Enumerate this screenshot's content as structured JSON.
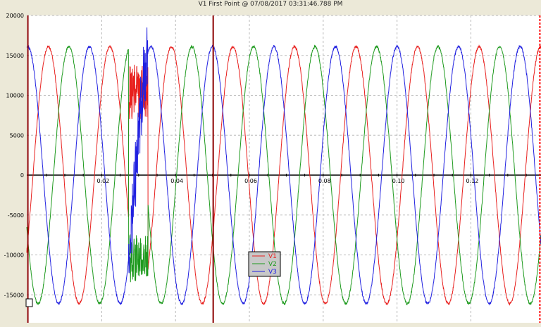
{
  "chart_data": {
    "type": "line",
    "title": "V1 First Point @ 07/08/2017 03:31:46.788 PM",
    "xlabel": "",
    "ylabel": "",
    "xlim": [
      -0.0003,
      0.139
    ],
    "ylim": [
      -18500,
      20000
    ],
    "grid": true,
    "legend_position": "bottom-center",
    "y_ticks": [
      20000,
      15000,
      10000,
      5000,
      0,
      -5000,
      -10000,
      -15000
    ],
    "x_ticks": [
      0.02,
      0.04,
      0.06,
      0.08,
      0.1,
      0.12
    ],
    "y_tick_labels": [
      "20000",
      "15000",
      "10000",
      "5000",
      "0",
      "-5000",
      "-10000",
      "-15000"
    ],
    "x_tick_labels": [
      "0.02",
      "0.04",
      "0.06",
      "0.08",
      "0.10",
      "0.12"
    ],
    "cursors": [
      {
        "name": "cursor-left",
        "x": 0.0,
        "color": "#8b0000"
      },
      {
        "name": "cursor-middle",
        "x": 0.0502,
        "color": "#8b0000"
      },
      {
        "name": "cursor-right",
        "x": 0.1387,
        "color": "#ff0000"
      }
    ],
    "series": [
      {
        "name": "V1",
        "color": "#e8201e",
        "amplitude": 16100,
        "frequency_hz": 60,
        "phase_deg": -30
      },
      {
        "name": "V2",
        "color": "#1e9a1e",
        "amplitude": 16100,
        "frequency_hz": 60,
        "phase_deg": -150
      },
      {
        "name": "V3",
        "color": "#2020e0",
        "amplitude": 16100,
        "frequency_hz": 60,
        "phase_deg": 90
      }
    ],
    "transient": {
      "start": 0.0273,
      "end": 0.0325
    }
  }
}
